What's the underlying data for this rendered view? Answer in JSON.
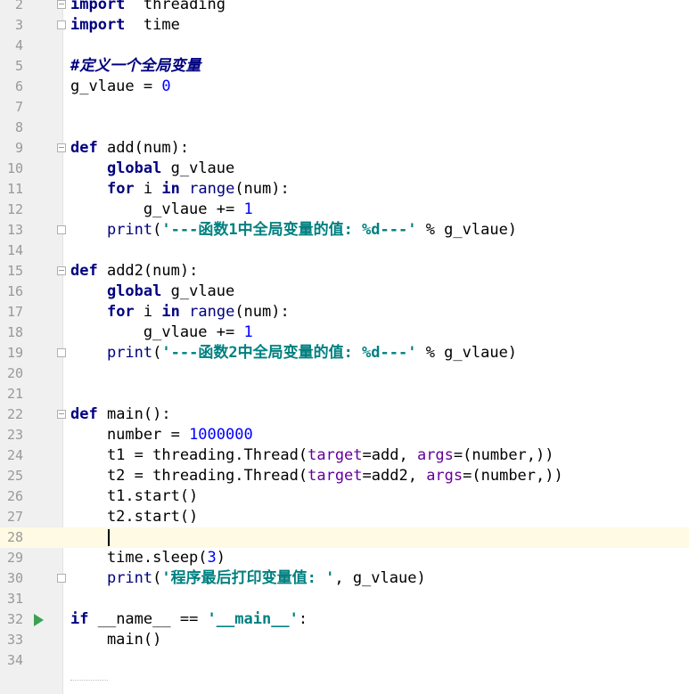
{
  "editor": {
    "lines": [
      {
        "n": "2",
        "tokens": [
          [
            "kw",
            "import"
          ],
          [
            "",
            "  threading"
          ]
        ]
      },
      {
        "n": "3",
        "tokens": [
          [
            "kw",
            "import"
          ],
          [
            "",
            "  time"
          ]
        ]
      },
      {
        "n": "4",
        "tokens": []
      },
      {
        "n": "5",
        "tokens": [
          [
            "cmt",
            "#定义一个全局变量"
          ]
        ]
      },
      {
        "n": "6",
        "tokens": [
          [
            "",
            "g_vlaue = "
          ],
          [
            "num",
            "0"
          ]
        ]
      },
      {
        "n": "7",
        "tokens": []
      },
      {
        "n": "8",
        "tokens": []
      },
      {
        "n": "9",
        "tokens": [
          [
            "kw",
            "def"
          ],
          [
            "",
            " add(num):"
          ]
        ]
      },
      {
        "n": "10",
        "tokens": [
          [
            "",
            "    "
          ],
          [
            "kw",
            "global"
          ],
          [
            "",
            " g_vlaue"
          ]
        ]
      },
      {
        "n": "11",
        "tokens": [
          [
            "",
            "    "
          ],
          [
            "kw",
            "for"
          ],
          [
            "",
            " i "
          ],
          [
            "kw",
            "in"
          ],
          [
            "",
            " "
          ],
          [
            "builtin",
            "range"
          ],
          [
            "",
            "(num):"
          ]
        ]
      },
      {
        "n": "12",
        "tokens": [
          [
            "",
            "        g_vlaue += "
          ],
          [
            "num",
            "1"
          ]
        ]
      },
      {
        "n": "13",
        "tokens": [
          [
            "",
            "    "
          ],
          [
            "builtin",
            "print"
          ],
          [
            "",
            "("
          ],
          [
            "str",
            "'---函数1中全局变量的值: %d---'"
          ],
          [
            "",
            " % g_vlaue)"
          ]
        ]
      },
      {
        "n": "14",
        "tokens": []
      },
      {
        "n": "15",
        "tokens": [
          [
            "kw",
            "def"
          ],
          [
            "",
            " add2(num):"
          ]
        ]
      },
      {
        "n": "16",
        "tokens": [
          [
            "",
            "    "
          ],
          [
            "kw",
            "global"
          ],
          [
            "",
            " g_vlaue"
          ]
        ]
      },
      {
        "n": "17",
        "tokens": [
          [
            "",
            "    "
          ],
          [
            "kw",
            "for"
          ],
          [
            "",
            " i "
          ],
          [
            "kw",
            "in"
          ],
          [
            "",
            " "
          ],
          [
            "builtin",
            "range"
          ],
          [
            "",
            "(num):"
          ]
        ]
      },
      {
        "n": "18",
        "tokens": [
          [
            "",
            "        g_vlaue += "
          ],
          [
            "num",
            "1"
          ]
        ]
      },
      {
        "n": "19",
        "tokens": [
          [
            "",
            "    "
          ],
          [
            "builtin",
            "print"
          ],
          [
            "",
            "("
          ],
          [
            "str",
            "'---函数2中全局变量的值: %d---'"
          ],
          [
            "",
            " % g_vlaue)"
          ]
        ]
      },
      {
        "n": "20",
        "tokens": []
      },
      {
        "n": "21",
        "tokens": []
      },
      {
        "n": "22",
        "tokens": [
          [
            "kw",
            "def"
          ],
          [
            "",
            " main():"
          ]
        ]
      },
      {
        "n": "23",
        "tokens": [
          [
            "",
            "    number = "
          ],
          [
            "num",
            "1000000"
          ]
        ]
      },
      {
        "n": "24",
        "tokens": [
          [
            "",
            "    t1 = threading.Thread("
          ],
          [
            "param",
            "target"
          ],
          [
            "",
            "=add, "
          ],
          [
            "param",
            "args"
          ],
          [
            "",
            "=(number,))"
          ]
        ]
      },
      {
        "n": "25",
        "tokens": [
          [
            "",
            "    t2 = threading.Thread("
          ],
          [
            "param",
            "target"
          ],
          [
            "",
            "=add2, "
          ],
          [
            "param",
            "args"
          ],
          [
            "",
            "=(number,))"
          ]
        ]
      },
      {
        "n": "26",
        "tokens": [
          [
            "",
            "    t1.start()"
          ]
        ]
      },
      {
        "n": "27",
        "tokens": [
          [
            "",
            "    t2.start()"
          ]
        ]
      },
      {
        "n": "28",
        "tokens": []
      },
      {
        "n": "29",
        "tokens": [
          [
            "",
            "    time.sleep("
          ],
          [
            "num",
            "3"
          ],
          [
            "",
            ")"
          ]
        ]
      },
      {
        "n": "30",
        "tokens": [
          [
            "",
            "    "
          ],
          [
            "builtin",
            "print"
          ],
          [
            "",
            "("
          ],
          [
            "str",
            "'程序最后打印变量值: '"
          ],
          [
            "",
            ", g_vlaue)"
          ]
        ]
      },
      {
        "n": "31",
        "tokens": []
      },
      {
        "n": "32",
        "tokens": [
          [
            "kw",
            "if"
          ],
          [
            "",
            " __name__ == "
          ],
          [
            "str",
            "'__main__'"
          ],
          [
            "",
            ":"
          ]
        ]
      },
      {
        "n": "33",
        "tokens": [
          [
            "",
            "    main()"
          ]
        ]
      },
      {
        "n": "34",
        "tokens": []
      }
    ],
    "current_line": "28",
    "fold_markers": [
      "2",
      "3",
      "9",
      "13",
      "15",
      "19",
      "22",
      "30"
    ],
    "run_gutter_line": "32"
  },
  "colors": {
    "keyword": "#000080",
    "string": "#008080",
    "number": "#0000ff",
    "run_icon": "#3aa155",
    "current_line_bg": "#fffae3"
  },
  "icons": {
    "run": "run-icon",
    "fold": "fold-marker-icon"
  }
}
